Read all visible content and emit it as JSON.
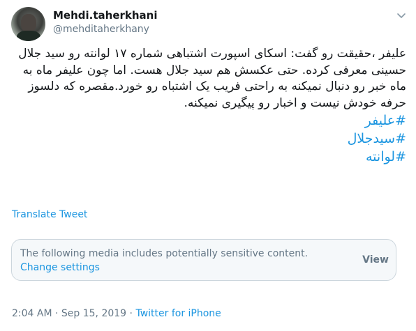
{
  "user": {
    "name": "Mehdi.taherkhani",
    "handle": "@mehditaherkhany"
  },
  "tweet": {
    "text": "علیفر ،حقیقت رو گفت: اسکای اسپورت اشتباهی شماره ۱۷ لوانته رو سید جلال حسینی معرفی کرده. حتی عکسش هم سید جلال هست. اما چون علیفر ماه به ماه خبر رو دنبال نمیکنه به راحتی فریب یک اشتباه رو خورد.مقصره که دلسوز حرفه خودش نیست و اخبار رو پیگیری نمیکنه.",
    "hashtags": [
      "#علیفر",
      "#سیدجلال",
      "#لوانته"
    ]
  },
  "translate_label": "Translate Tweet",
  "sensitive": {
    "message": "The following media includes potentially sensitive content.",
    "change_label": "Change settings",
    "view_label": "View"
  },
  "meta": {
    "time": "2:04 AM",
    "separator": " · ",
    "date": "Sep 15, 2019",
    "source": "Twitter for iPhone"
  },
  "icons": {
    "caret": "chevron-down-icon"
  },
  "colors": {
    "link": "#1b95e0",
    "secondary_text": "#657786",
    "border": "#ccd6dd",
    "box_bg": "#f5f8fa"
  }
}
